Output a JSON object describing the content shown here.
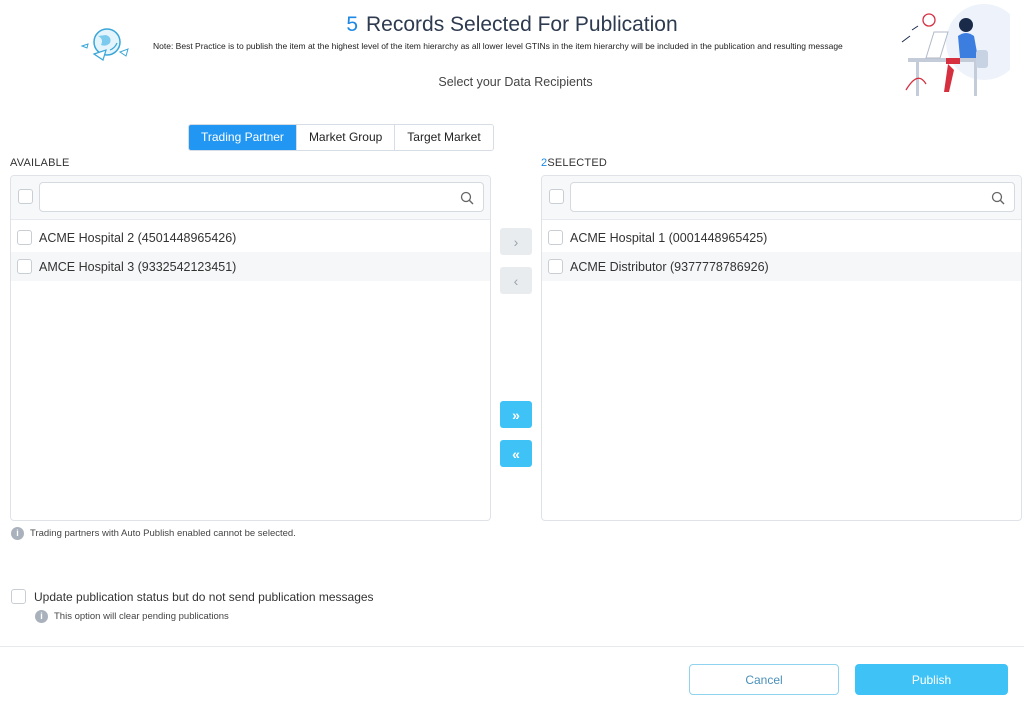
{
  "header": {
    "count": "5",
    "title": "Records Selected For Publication",
    "note": "Note: Best Practice is to publish the item at the highest level of the item hierarchy as all lower level GTINs in the item hierarchy will be included in the publication and resulting message",
    "subtitle": "Select your Data Recipients"
  },
  "tabs": [
    {
      "label": "Trading Partner",
      "active": true
    },
    {
      "label": "Market Group",
      "active": false
    },
    {
      "label": "Target Market",
      "active": false
    }
  ],
  "available": {
    "label": "AVAILABLE",
    "search_value": "",
    "items": [
      "ACME Hospital 2 (4501448965426)",
      "AMCE Hospital 3 (9332542123451)"
    ]
  },
  "selected": {
    "count": "2",
    "label": "SELECTED",
    "search_value": "",
    "items": [
      "ACME Hospital 1 (0001448965425)",
      "ACME Distributor (9377778786926)"
    ]
  },
  "move_buttons": {
    "right": "›",
    "left": "‹",
    "all_right": "»",
    "all_left": "«"
  },
  "hints": {
    "auto_publish": "Trading partners with Auto Publish enabled cannot be selected.",
    "update_label": "Update publication status but do not send publication messages",
    "clear_pending": "This option will clear pending publications"
  },
  "footer": {
    "cancel": "Cancel",
    "publish": "Publish"
  },
  "colors": {
    "accent": "#2196f3",
    "button": "#3fc3f7"
  }
}
